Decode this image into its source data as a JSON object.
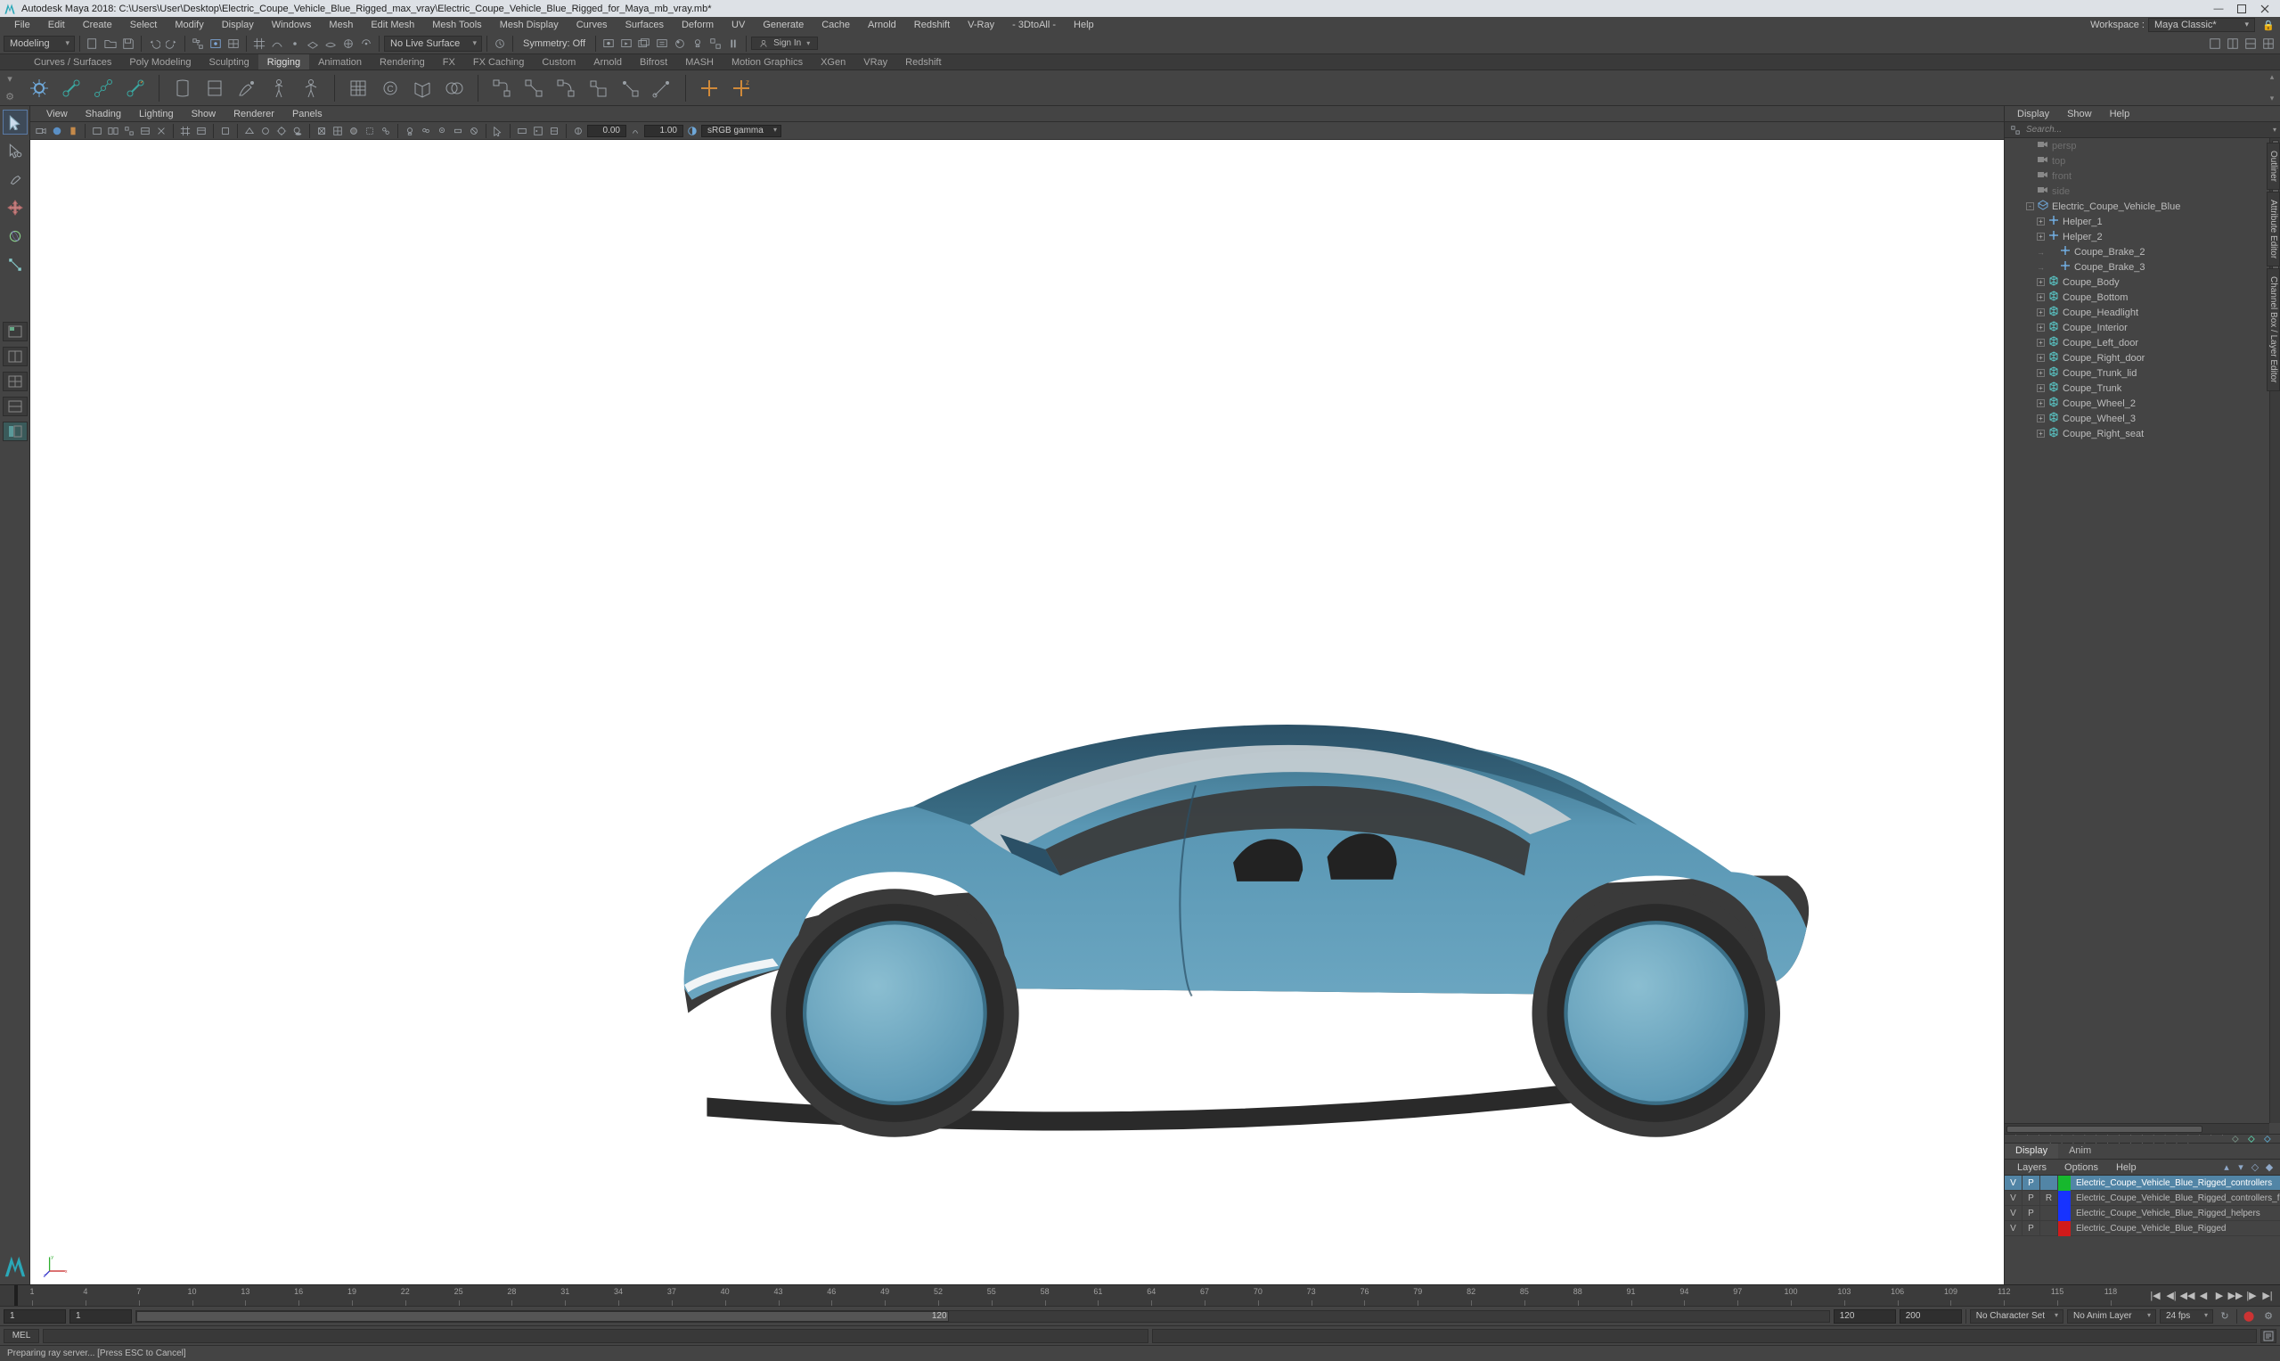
{
  "title_bar": "Autodesk Maya 2018: C:\\Users\\User\\Desktop\\Electric_Coupe_Vehicle_Blue_Rigged_max_vray\\Electric_Coupe_Vehicle_Blue_Rigged_for_Maya_mb_vray.mb*",
  "main_menu": [
    "File",
    "Edit",
    "Create",
    "Select",
    "Modify",
    "Display",
    "Windows",
    "Mesh",
    "Edit Mesh",
    "Mesh Tools",
    "Mesh Display",
    "Curves",
    "Surfaces",
    "Deform",
    "UV",
    "Generate",
    "Cache",
    "Arnold",
    "Redshift",
    "V-Ray",
    "- 3DtoAll -",
    "Help"
  ],
  "workspace_label": "Workspace :",
  "workspace_value": "Maya Classic*",
  "status": {
    "menuset": "Modeling",
    "surface": "No Live Surface",
    "symmetry": "Symmetry: Off",
    "signin": "Sign In"
  },
  "shelf_tabs": [
    "Curves / Surfaces",
    "Poly Modeling",
    "Sculpting",
    "Rigging",
    "Animation",
    "Rendering",
    "FX",
    "FX Caching",
    "Custom",
    "Arnold",
    "Bifrost",
    "MASH",
    "Motion Graphics",
    "XGen",
    "VRay",
    "Redshift"
  ],
  "shelf_active": "Rigging",
  "panel_menu": [
    "View",
    "Shading",
    "Lighting",
    "Show",
    "Renderer",
    "Panels"
  ],
  "panel_toolbar": {
    "expA": "0.00",
    "expB": "1.00",
    "gamma": "sRGB gamma"
  },
  "outliner": {
    "menu": [
      "Display",
      "Show",
      "Help"
    ],
    "search_placeholder": "Search...",
    "cameras": [
      "persp",
      "top",
      "front",
      "side"
    ],
    "root": "Electric_Coupe_Vehicle_Blue",
    "children": [
      {
        "name": "Helper_1",
        "icon": "loc",
        "expand": true
      },
      {
        "name": "Helper_2",
        "icon": "loc",
        "expand": true
      },
      {
        "name": "Coupe_Brake_2",
        "icon": "loc",
        "expand": false
      },
      {
        "name": "Coupe_Brake_3",
        "icon": "loc",
        "expand": false
      },
      {
        "name": "Coupe_Body",
        "icon": "mesh",
        "expand": true
      },
      {
        "name": "Coupe_Bottom",
        "icon": "mesh",
        "expand": true
      },
      {
        "name": "Coupe_Headlight",
        "icon": "mesh",
        "expand": true
      },
      {
        "name": "Coupe_Interior",
        "icon": "mesh",
        "expand": true
      },
      {
        "name": "Coupe_Left_door",
        "icon": "mesh",
        "expand": true
      },
      {
        "name": "Coupe_Right_door",
        "icon": "mesh",
        "expand": true
      },
      {
        "name": "Coupe_Trunk_lid",
        "icon": "mesh",
        "expand": true
      },
      {
        "name": "Coupe_Trunk",
        "icon": "mesh",
        "expand": true
      },
      {
        "name": "Coupe_Wheel_2",
        "icon": "mesh",
        "expand": true
      },
      {
        "name": "Coupe_Wheel_3",
        "icon": "mesh",
        "expand": true
      },
      {
        "name": "Coupe_Right_seat",
        "icon": "mesh",
        "expand": true
      }
    ]
  },
  "layers": {
    "tabs": [
      "Display",
      "Anim"
    ],
    "menu": [
      "Layers",
      "Options",
      "Help"
    ],
    "items": [
      {
        "v": "V",
        "p": "P",
        "r": "",
        "color": "#17b82e",
        "name": "Electric_Coupe_Vehicle_Blue_Rigged_controllers",
        "selected": true
      },
      {
        "v": "V",
        "p": "P",
        "r": "R",
        "color": "#1733ff",
        "name": "Electric_Coupe_Vehicle_Blue_Rigged_controllers_freeze",
        "selected": false
      },
      {
        "v": "V",
        "p": "P",
        "r": "",
        "color": "#1733ff",
        "name": "Electric_Coupe_Vehicle_Blue_Rigged_helpers",
        "selected": false
      },
      {
        "v": "V",
        "p": "P",
        "r": "",
        "color": "#d21a1a",
        "name": "Electric_Coupe_Vehicle_Blue_Rigged",
        "selected": false
      }
    ]
  },
  "time": {
    "ruler_start": 1,
    "ruler_step": 3,
    "ruler_count": 40,
    "start_outer": "1",
    "start_inner": "1",
    "end_inner": "120",
    "end_outer": "200",
    "range_label": "120",
    "charset": "No Character Set",
    "animlayer": "No Anim Layer",
    "fps": "24 fps"
  },
  "cmd": {
    "lang": "MEL"
  },
  "helpline": "Preparing ray server... [Press ESC to Cancel]",
  "edge_tabs": [
    "Outliner",
    "Attribute Editor",
    "Channel Box / Layer Editor"
  ]
}
